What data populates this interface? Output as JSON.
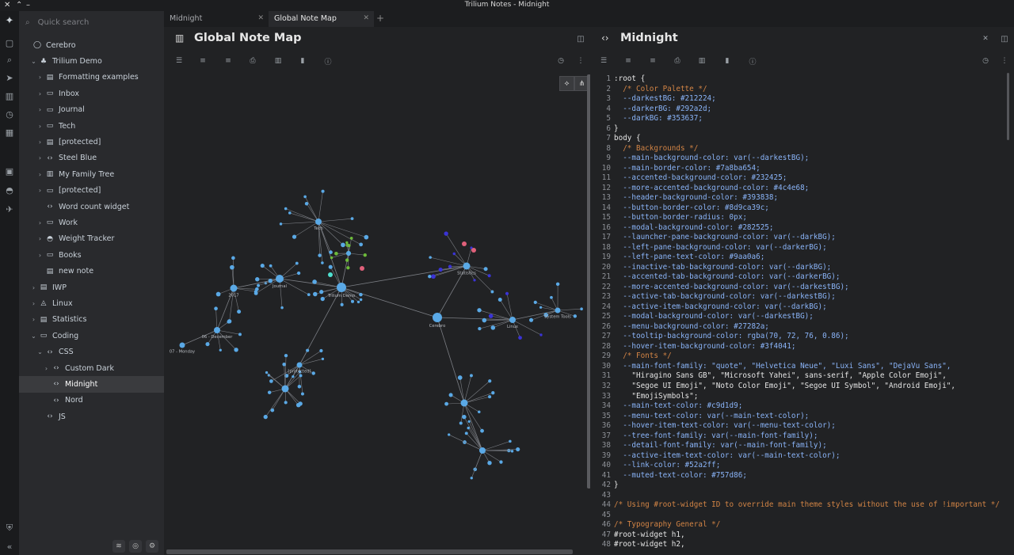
{
  "window": {
    "title": "Trilium Notes - Midnight"
  },
  "search": {
    "placeholder": "Quick search"
  },
  "tree": [
    {
      "label": "Cerebro",
      "icon": "circle-icon",
      "indent": 0,
      "chev": ""
    },
    {
      "label": "Trilium Demo",
      "icon": "tree-icon",
      "indent": 1,
      "chev": "⌄"
    },
    {
      "label": "Formatting examples",
      "icon": "note-icon",
      "indent": 2,
      "chev": "›"
    },
    {
      "label": "Inbox",
      "icon": "folder-icon",
      "indent": 2,
      "chev": "›"
    },
    {
      "label": "Journal",
      "icon": "folder-icon",
      "indent": 2,
      "chev": "›"
    },
    {
      "label": "Tech",
      "icon": "folder-icon",
      "indent": 2,
      "chev": "›"
    },
    {
      "label": "[protected]",
      "icon": "note-icon",
      "indent": 2,
      "chev": "›"
    },
    {
      "label": "Steel Blue",
      "icon": "code-icon",
      "indent": 2,
      "chev": "›"
    },
    {
      "label": "My Family Tree",
      "icon": "map-icon",
      "indent": 2,
      "chev": "›"
    },
    {
      "label": "[protected]",
      "icon": "folder-icon",
      "indent": 2,
      "chev": "›"
    },
    {
      "label": "Word count widget",
      "icon": "code-icon",
      "indent": 2,
      "chev": ""
    },
    {
      "label": "Work",
      "icon": "folder-icon",
      "indent": 2,
      "chev": "›"
    },
    {
      "label": "Weight Tracker",
      "icon": "gauge-icon",
      "indent": 2,
      "chev": "›"
    },
    {
      "label": "Books",
      "icon": "folder-icon",
      "indent": 2,
      "chev": "›"
    },
    {
      "label": "new note",
      "icon": "note-icon",
      "indent": 2,
      "chev": ""
    },
    {
      "label": "IWP",
      "icon": "note-icon",
      "indent": 1,
      "chev": "›"
    },
    {
      "label": "Linux",
      "icon": "linux-icon",
      "indent": 1,
      "chev": "›"
    },
    {
      "label": "Statistics",
      "icon": "note-icon",
      "indent": 1,
      "chev": "›"
    },
    {
      "label": "Coding",
      "icon": "folder-icon",
      "indent": 1,
      "chev": "⌄"
    },
    {
      "label": "CSS",
      "icon": "code-icon",
      "indent": 2,
      "chev": "⌄"
    },
    {
      "label": "Custom Dark",
      "icon": "code-icon",
      "indent": 3,
      "chev": "›"
    },
    {
      "label": "Midnight",
      "icon": "code-icon",
      "indent": 3,
      "chev": "",
      "active": true
    },
    {
      "label": "Nord",
      "icon": "code-icon",
      "indent": 3,
      "chev": ""
    },
    {
      "label": "JS",
      "icon": "code-icon",
      "indent": 2,
      "chev": ""
    }
  ],
  "tabs": [
    {
      "label": "Midnight",
      "active": false
    },
    {
      "label": "Global Note Map",
      "active": true
    }
  ],
  "left_note": {
    "title": "Global Note Map"
  },
  "right_note": {
    "title": "Midnight"
  },
  "graph_labels": [
    "Trilium Demo",
    "Cerebro",
    "Journal",
    "2017",
    "Tech",
    "Statistics",
    "Linux",
    "System Tools",
    "[protected]",
    "06 - December",
    "07 - Monday"
  ],
  "code_lines": [
    ":root {",
    "  /* Color Palette */",
    "  --darkestBG: #212224;",
    "  --darkerBG: #292a2d;",
    "  --darkBG: #353637;",
    "}",
    "body {",
    "  /* Backgrounds */",
    "  --main-background-color: var(--darkestBG);",
    "  --main-border-color: #7a8ba654;",
    "  --accented-background-color: #232425;",
    "  --more-accented-background-color: #4c4e68;",
    "  --header-background-color: #393838;",
    "  --button-border-color: #8d9ca39c;",
    "  --button-border-radius: 0px;",
    "  --modal-background-color: #282525;",
    "  --launcher-pane-background-color: var(--darkBG);",
    "  --left-pane-background-color: var(--darkerBG);",
    "  --left-pane-text-color: #9aa0a6;",
    "  --inactive-tab-background-color: var(--darkBG);",
    "  --accented-tab-background-color: var(--darkerBG);",
    "  --more-accented-background-color: var(--darkestBG);",
    "  --active-tab-background-color: var(--darkestBG);",
    "  --active-item-background-color: var(--darkBG);",
    "  --modal-background-color: var(--darkestBG);",
    "  --menu-background-color: #27282a;",
    "  --tooltip-background-color: rgba(70, 72, 76, 0.86);",
    "  --hover-item-background-color: #3f4041;",
    "  /* Fonts */",
    "  --main-font-family: \"quote\", \"Helvetica Neue\", \"Luxi Sans\", \"DejaVu Sans\",",
    "    \"Hiragino Sans GB\", \"Microsoft Yahei\", sans-serif, \"Apple Color Emoji\",",
    "    \"Segoe UI Emoji\", \"Noto Color Emoji\", \"Segoe UI Symbol\", \"Android Emoji\",",
    "    \"EmojiSymbols\";",
    "  --main-text-color: #c9d1d9;",
    "  --menu-text-color: var(--main-text-color);",
    "  --hover-item-text-color: var(--menu-text-color);",
    "  --tree-font-family: var(--main-font-family);",
    "  --detail-font-family: var(--main-font-family);",
    "  --active-item-text-color: var(--main-text-color);",
    "  --link-color: #52a2ff;",
    "  --muted-text-color: #757d86;",
    "}",
    "",
    "/* Using #root-widget ID to override main theme styles without the use of !important */",
    "",
    "/* Typography General */",
    "#root-widget h1,",
    "#root-widget h2,"
  ],
  "colors": {
    "node": "#5aa9e6",
    "link": "#7a7d83",
    "accent_blue": "#3a33d6",
    "accent_red": "#e0607a",
    "accent_green": "#6dbb3a",
    "accent_cyan": "#4fe0d0"
  }
}
